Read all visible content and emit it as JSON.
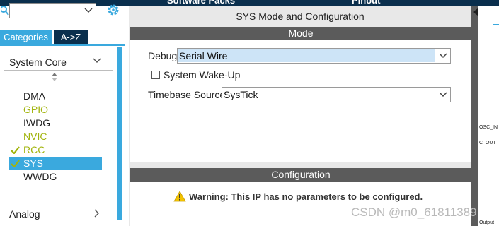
{
  "header": {
    "left_tab": "Software Packs",
    "right_tab": "Pinout"
  },
  "sidebar": {
    "search": {
      "value": "",
      "placeholder": ""
    },
    "tabs": [
      {
        "label": "Categories",
        "active": true
      },
      {
        "label": "A->Z",
        "active": false
      }
    ],
    "section_title": "System Core",
    "items": [
      {
        "label": "DMA",
        "color": "#1e1e1e",
        "checked": false,
        "selected": false
      },
      {
        "label": "GPIO",
        "color": "#a2b40d",
        "checked": false,
        "selected": false
      },
      {
        "label": "IWDG",
        "color": "#1e1e1e",
        "checked": false,
        "selected": false
      },
      {
        "label": "NVIC",
        "color": "#a2b40d",
        "checked": false,
        "selected": false
      },
      {
        "label": "RCC",
        "color": "#a2b40d",
        "checked": true,
        "selected": false
      },
      {
        "label": "SYS",
        "color": "#ffffff",
        "checked": true,
        "selected": true
      },
      {
        "label": "WWDG",
        "color": "#1e1e1e",
        "checked": false,
        "selected": false
      }
    ],
    "next_section": "Analog"
  },
  "main": {
    "title": "SYS Mode and Configuration",
    "mode": {
      "header": "Mode",
      "debug": {
        "label": "Debug",
        "value": "Serial Wire"
      },
      "wakeup": {
        "label": "System Wake-Up",
        "checked": false
      },
      "timebase": {
        "label": "Timebase Source",
        "value": "SysTick"
      }
    },
    "configuration": {
      "header": "Configuration",
      "warning": "Warning: This IP has no parameters to be configured."
    }
  },
  "right": {
    "pins": [
      "OSC_IN",
      "C_OUT",
      "Output"
    ]
  },
  "watermark": "CSDN @m0_61811389",
  "colors": {
    "accent": "#3aa9de",
    "header_dark": "#0a2f4d",
    "section_bar": "#5b5b5b",
    "configured_green": "#a2b40d",
    "warning_yellow": "#f2c200"
  }
}
